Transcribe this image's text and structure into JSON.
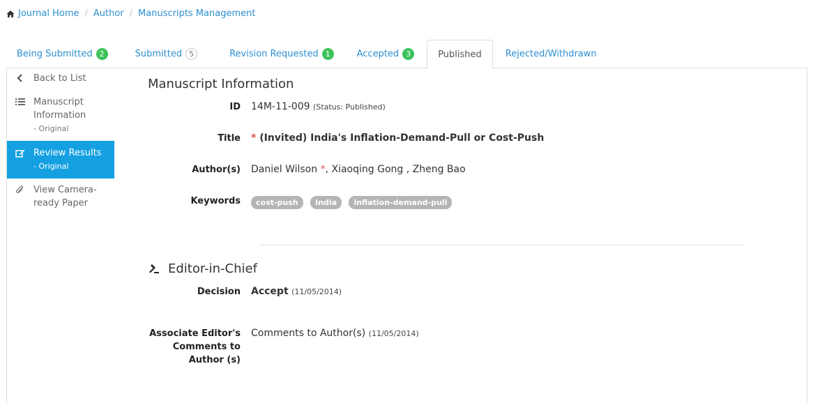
{
  "breadcrumb": {
    "home": "Journal Home",
    "author": "Author",
    "manuscripts": "Manuscripts Management"
  },
  "tabs": [
    {
      "label": "Being Submitted",
      "badge": "2"
    },
    {
      "label": "Submitted",
      "badge": "5"
    },
    {
      "label": "Revision Requested",
      "badge": "1"
    },
    {
      "label": "Accepted",
      "badge": "3"
    },
    {
      "label": "Published",
      "badge": ""
    },
    {
      "label": "Rejected/Withdrawn",
      "badge": ""
    }
  ],
  "sidebar": {
    "back": "Back to List",
    "items": [
      {
        "label": "Manuscript Information",
        "sub": "- Original"
      },
      {
        "label": "Review Results",
        "sub": "- Original"
      },
      {
        "label": "View Camera-ready Paper",
        "sub": ""
      }
    ]
  },
  "manuscript": {
    "section_title": "Manuscript Information",
    "id_label": "ID",
    "id_value": "14M-11-009",
    "status": "(Status: Published)",
    "title_label": "Title",
    "title_star": "*",
    "title_value": "(Invited) India's Inflation-Demand-Pull or Cost-Push",
    "authors_label": "Author(s)",
    "author_1": "Daniel Wilson",
    "author_star": "*",
    "authors_rest": ", Xiaoqing Gong , Zheng Bao",
    "keywords_label": "Keywords",
    "keywords": [
      "cost-push",
      "India",
      "inflation-demand-pull"
    ]
  },
  "editor": {
    "section_title": "Editor-in-Chief",
    "decision_label": "Decision",
    "decision_value": "Accept",
    "decision_date": "(11/05/2014)",
    "comments_label": "Associate Editor's Comments to Author (s)",
    "comments_value": "Comments to Author(s)",
    "comments_date": "(11/05/2014)"
  },
  "colors": {
    "link": "#2e8fcf",
    "badge": "#3cc35a",
    "active": "#14a0e1",
    "required": "#d9534f"
  }
}
